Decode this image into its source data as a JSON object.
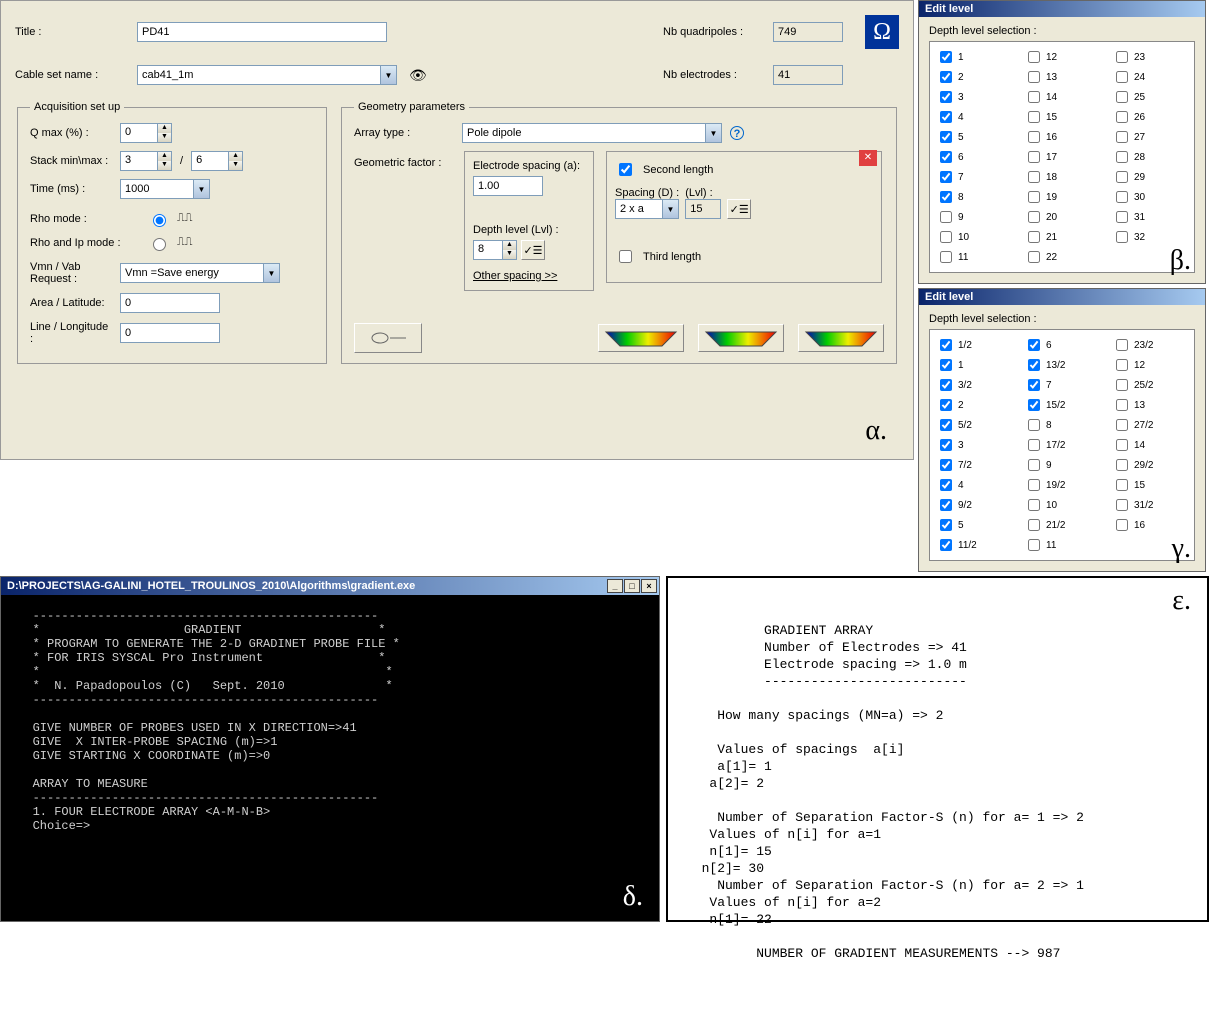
{
  "main": {
    "title_label": "Title :",
    "title_value": "PD41",
    "cable_label": "Cable set name :",
    "cable_value": "cab41_1m",
    "nb_quad_label": "Nb quadripoles :",
    "nb_quad_value": "749",
    "nb_elec_label": "Nb electrodes :",
    "nb_elec_value": "41",
    "omega": "Ω",
    "acq": {
      "legend": "Acquisition set up",
      "qmax_label": "Q max (%) :",
      "qmax_value": "0",
      "stack_label": "Stack min\\max :",
      "stack_min": "3",
      "stack_sep": "/",
      "stack_max": "6",
      "time_label": "Time (ms) :",
      "time_value": "1000",
      "rho_label": "Rho mode :",
      "rhoip_label": "Rho and Ip mode :",
      "vmn_label": "Vmn / Vab Request :",
      "vmn_value": "Vmn =Save energy",
      "area_label": "Area / Latitude:",
      "area_value": "0",
      "line_label": "Line / Longitude :",
      "line_value": "0"
    },
    "geom": {
      "legend": "Geometry parameters",
      "array_label": "Array type :",
      "array_value": "Pole dipole",
      "help": "?",
      "gf_label": "Geometric factor :",
      "espacing_label": "Electrode spacing (a):",
      "espacing_value": "1.00",
      "depth_label": "Depth level  (Lvl) :",
      "depth_value": "8",
      "other_spacing": "Other spacing  >>",
      "second_len_label": "Second length",
      "second_len_checked": true,
      "spacing_d_label": "Spacing (D) :",
      "spacing_d_value": "2 x a",
      "lvl_label": "(Lvl) :",
      "lvl_value": "15",
      "third_len_label": "Third length",
      "third_len_checked": false,
      "close_x": "✕"
    },
    "greek_alpha": "α."
  },
  "edit_beta": {
    "title": "Edit level",
    "sub": "Depth level selection :",
    "greek": "β.",
    "cols": [
      [
        {
          "label": "1",
          "checked": true
        },
        {
          "label": "2",
          "checked": true
        },
        {
          "label": "3",
          "checked": true
        },
        {
          "label": "4",
          "checked": true
        },
        {
          "label": "5",
          "checked": true
        },
        {
          "label": "6",
          "checked": true
        },
        {
          "label": "7",
          "checked": true
        },
        {
          "label": "8",
          "checked": true
        },
        {
          "label": "9",
          "checked": false
        },
        {
          "label": "10",
          "checked": false
        },
        {
          "label": "11",
          "checked": false
        }
      ],
      [
        {
          "label": "12",
          "checked": false
        },
        {
          "label": "13",
          "checked": false
        },
        {
          "label": "14",
          "checked": false
        },
        {
          "label": "15",
          "checked": false
        },
        {
          "label": "16",
          "checked": false
        },
        {
          "label": "17",
          "checked": false
        },
        {
          "label": "18",
          "checked": false
        },
        {
          "label": "19",
          "checked": false
        },
        {
          "label": "20",
          "checked": false
        },
        {
          "label": "21",
          "checked": false
        },
        {
          "label": "22",
          "checked": false
        }
      ],
      [
        {
          "label": "23",
          "checked": false
        },
        {
          "label": "24",
          "checked": false
        },
        {
          "label": "25",
          "checked": false
        },
        {
          "label": "26",
          "checked": false
        },
        {
          "label": "27",
          "checked": false
        },
        {
          "label": "28",
          "checked": false
        },
        {
          "label": "29",
          "checked": false
        },
        {
          "label": "30",
          "checked": false
        },
        {
          "label": "31",
          "checked": false
        },
        {
          "label": "32",
          "checked": false
        }
      ]
    ]
  },
  "edit_gamma": {
    "title": "Edit level",
    "sub": "Depth level selection :",
    "greek": "γ.",
    "cols": [
      [
        {
          "label": "1/2",
          "checked": true
        },
        {
          "label": "1",
          "checked": true
        },
        {
          "label": "3/2",
          "checked": true
        },
        {
          "label": "2",
          "checked": true
        },
        {
          "label": "5/2",
          "checked": true
        },
        {
          "label": "3",
          "checked": true
        },
        {
          "label": "7/2",
          "checked": true
        },
        {
          "label": "4",
          "checked": true
        },
        {
          "label": "9/2",
          "checked": true
        },
        {
          "label": "5",
          "checked": true
        },
        {
          "label": "11/2",
          "checked": true
        }
      ],
      [
        {
          "label": "6",
          "checked": true
        },
        {
          "label": "13/2",
          "checked": true
        },
        {
          "label": "7",
          "checked": true
        },
        {
          "label": "15/2",
          "checked": true
        },
        {
          "label": "8",
          "checked": false
        },
        {
          "label": "17/2",
          "checked": false
        },
        {
          "label": "9",
          "checked": false
        },
        {
          "label": "19/2",
          "checked": false
        },
        {
          "label": "10",
          "checked": false
        },
        {
          "label": "21/2",
          "checked": false
        },
        {
          "label": "11",
          "checked": false
        }
      ],
      [
        {
          "label": "23/2",
          "checked": false
        },
        {
          "label": "12",
          "checked": false
        },
        {
          "label": "25/2",
          "checked": false
        },
        {
          "label": "13",
          "checked": false
        },
        {
          "label": "27/2",
          "checked": false
        },
        {
          "label": "14",
          "checked": false
        },
        {
          "label": "29/2",
          "checked": false
        },
        {
          "label": "15",
          "checked": false
        },
        {
          "label": "31/2",
          "checked": false
        },
        {
          "label": "16",
          "checked": false
        }
      ]
    ]
  },
  "console": {
    "title": "D:\\PROJECTS\\AG-GALINI_HOTEL_TROULINOS_2010\\Algorithms\\gradient.exe",
    "greek": "δ.",
    "text": "   ------------------------------------------------\n   *                    GRADIENT                   *\n   * PROGRAM TO GENERATE THE 2-D GRADINET PROBE FILE *\n   * FOR IRIS SYSCAL Pro Instrument                *\n   *                                                *\n   *  N. Papadopoulos (C)   Sept. 2010              *\n   ------------------------------------------------\n\n   GIVE NUMBER OF PROBES USED IN X DIRECTION=>41\n   GIVE  X INTER-PROBE SPACING (m)=>1\n   GIVE STARTING X COORDINATE (m)=>0\n\n   ARRAY TO MEASURE\n   ------------------------------------------------\n   1. FOUR ELECTRODE ARRAY <A-M-N-B>\n   Choice=>"
  },
  "output": {
    "greek": "ε.",
    "text": "          GRADIENT ARRAY\n          Number of Electrodes => 41\n          Electrode spacing => 1.0 m\n          --------------------------\n\n    How many spacings (MN=a) => 2\n\n    Values of spacings  a[i]\n    a[1]= 1\n   a[2]= 2\n\n    Number of Separation Factor-S (n) for a= 1 => 2\n   Values of n[i] for a=1\n   n[1]= 15\n  n[2]= 30\n    Number of Separation Factor-S (n) for a= 2 => 1\n   Values of n[i] for a=2\n   n[1]= 22\n\n         NUMBER OF GRADIENT MEASUREMENTS --> 987"
  }
}
